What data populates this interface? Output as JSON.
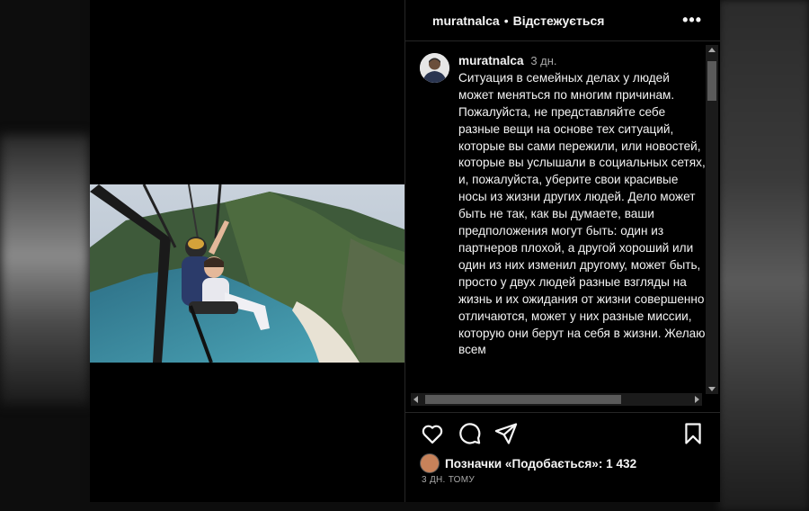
{
  "post": {
    "username": "muratnalca",
    "separator": "•",
    "follow_label": "Відстежується",
    "more_label": "•••"
  },
  "comment": {
    "username": "muratnalca",
    "time": "3 дн.",
    "text": "Ситуация в семейных делах у людей может меняться по многим причинам. Пожалуйста, не представляйте себе разные вещи на основе тех ситуаций, которые вы сами пережили, или новостей, которые вы услышали в социальных сетях, и, пожалуйста, уберите свои красивые носы из жизни других людей. Дело может быть не так, как вы думаете, ваши предположения могут быть: один из партнеров плохой, а другой хороший или один из них изменил другому, может быть, просто у двух людей разные взгляды на жизнь и их ожидания от жизни совершенно отличаются, может у них разные миссии, которую они берут на себя в жизни. Желаю всем"
  },
  "actions": {
    "like_icon": "heart-icon",
    "comment_icon": "comment-icon",
    "share_icon": "send-icon",
    "save_icon": "bookmark-icon"
  },
  "likes": {
    "text": "Позначки «Подобається»: 1 432"
  },
  "time_ago": "3 ДН. ТОМУ",
  "colors": {
    "background": "#000000",
    "divider": "#262626",
    "muted": "#a8a8a8"
  }
}
